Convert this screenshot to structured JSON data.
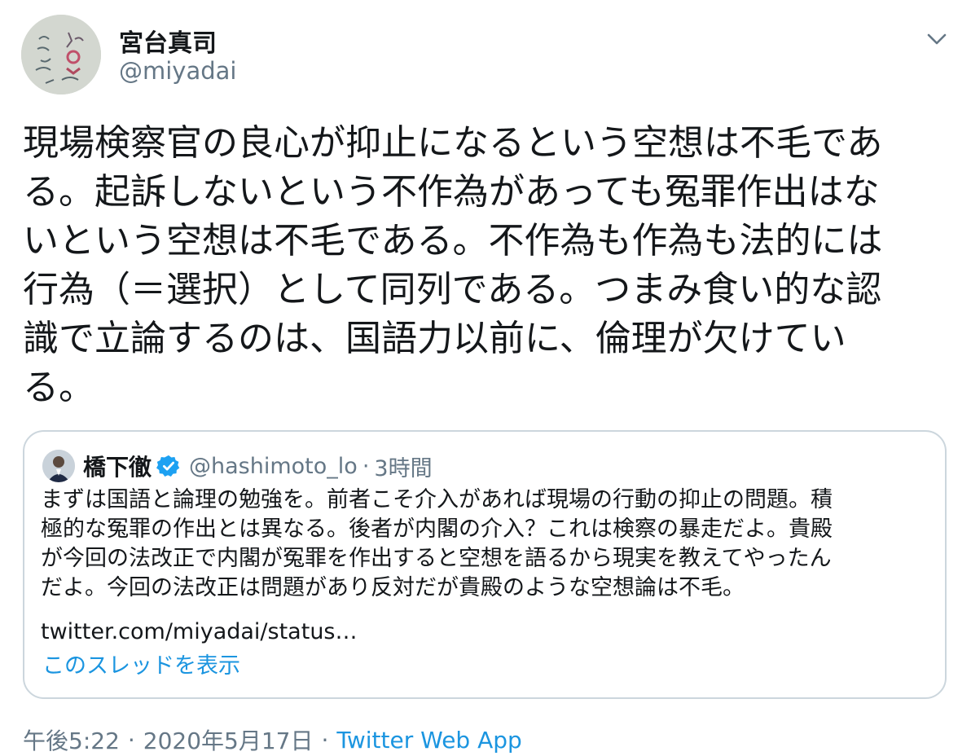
{
  "author": {
    "display_name": "宮台真司",
    "handle": "@miyadai",
    "avatar_icon": "profile-photo-icon"
  },
  "tweet": {
    "text": "現場検察官の良心が抑止になるという空想は不毛であ\nる。起訴しないという不作為があっても冤罪作出はな\nいという空想は不毛である。不作為も作為も法的には\n行為（＝選択）として同列である。つまみ食い的な認\n識で立論するのは、国語力以前に、倫理が欠けてい\nる。"
  },
  "quoted_tweet": {
    "display_name": "橋下徹",
    "handle": "@hashimoto_lo",
    "dot": "·",
    "time": "3時間",
    "verified_icon": "verified-badge-icon",
    "text": "まずは国語と論理の勉強を。前者こそ介入があれば現場の行動の抑止の問題。積\n極的な冤罪の作出とは異なる。後者が内閣の介入？これは検察の暴走だよ。貴殿\nが今回の法改正で内閣が冤罪を作出すると空想を語るから現実を教えてやったん\nだよ。今回の法改正は問題があり反対だが貴殿のような空想論は不毛。",
    "link": "twitter.com/miyadai/status…",
    "show_thread": "このスレッドを表示"
  },
  "meta": {
    "time": "午後5:22",
    "sep1": "·",
    "date": "2020年5月17日",
    "sep2": "·",
    "source": "Twitter Web App"
  },
  "colors": {
    "text": "#14171a",
    "secondary": "#657786",
    "link": "#1b95e0",
    "border": "#ccd6dd"
  }
}
